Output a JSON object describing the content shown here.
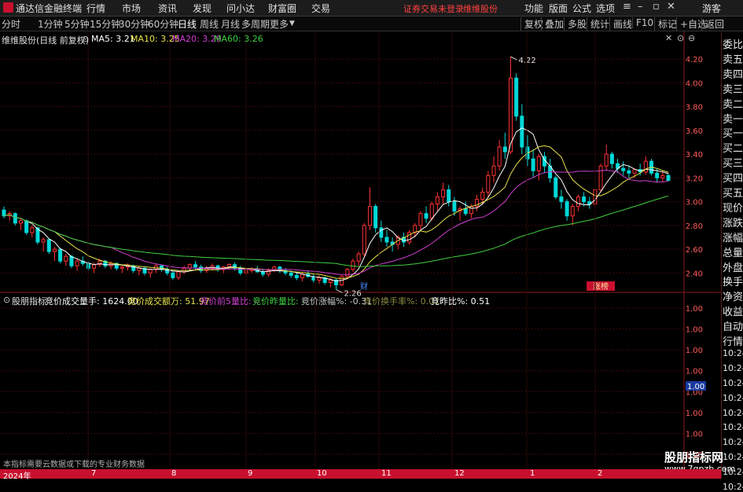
{
  "menubar": {
    "app_name": "通达信金融终端",
    "items": [
      "行情",
      "市场",
      "资讯",
      "发现",
      "问小达",
      "财富圈",
      "交易"
    ],
    "warning": "证券交易未登录",
    "stock_name": "维维股份",
    "right_items": [
      "功能",
      "版面",
      "公式",
      "选项"
    ],
    "guest": "游客"
  },
  "periodbar": {
    "items": [
      "分时",
      "1分钟",
      "5分钟",
      "15分钟",
      "30分钟",
      "60分钟",
      "日线",
      "周线",
      "月线",
      "多周期",
      "更多"
    ],
    "active_index": 6,
    "tools": [
      "复权",
      "叠加",
      "多股",
      "统计",
      "画线",
      "F10",
      "标记",
      "+自选",
      "返回"
    ]
  },
  "main_legend": {
    "title": "维维股份(日线 前复权)",
    "ma": [
      {
        "label": "MA5: 3.21",
        "color": "#ffffff"
      },
      {
        "label": "MA10: 3.25",
        "color": "#e8e34a"
      },
      {
        "label": "MA20: 3.29",
        "color": "#d040d0"
      },
      {
        "label": "MA60: 3.26",
        "color": "#40d040"
      }
    ]
  },
  "sub_legend": {
    "title": "股朋指标",
    "items": [
      {
        "label": "竞价成交量手: 1624.00",
        "color": "#ffffff"
      },
      {
        "label": "竞价成交额万: 51.97",
        "color": "#e8e34a"
      },
      {
        "label": "竞价前5量比: -",
        "color": "#d040d0"
      },
      {
        "label": "竞价昨量比: -",
        "color": "#40d040"
      },
      {
        "label": "竞价涨幅%: -0.31",
        "color": "#c8c8c8"
      },
      {
        "label": "竞价换手率%: 0.01",
        "color": "#8a8a40"
      },
      {
        "label": "竞昨比%: 0.51",
        "color": "#ffffff"
      }
    ]
  },
  "chart_data": [
    {
      "type": "candlestick",
      "title": "维维股份(日线 前复权)",
      "y_ticks": [
        "4.20",
        "4.00",
        "3.80",
        "3.60",
        "3.40",
        "3.20",
        "3.00",
        "2.80",
        "2.60",
        "2.40"
      ],
      "ylim": [
        2.25,
        4.32
      ],
      "x_labels": [
        "2024年",
        "7",
        "8",
        "9",
        "10",
        "11",
        "12",
        "1",
        "2"
      ],
      "annotations": [
        {
          "text": "4.22",
          "value": 4.22
        },
        {
          "text": "2.26",
          "value": 2.26
        }
      ],
      "markers": [
        {
          "text": "财",
          "color": "#4a8cff"
        },
        {
          "text": "涨榜"
        }
      ],
      "series_names": [
        "MA5",
        "MA10",
        "MA20",
        "MA60"
      ],
      "candles": [
        [
          2.93,
          2.96,
          2.86,
          2.88
        ],
        [
          2.88,
          2.92,
          2.84,
          2.9
        ],
        [
          2.9,
          2.91,
          2.8,
          2.82
        ],
        [
          2.82,
          2.86,
          2.76,
          2.84
        ],
        [
          2.84,
          2.85,
          2.72,
          2.74
        ],
        [
          2.74,
          2.8,
          2.7,
          2.78
        ],
        [
          2.78,
          2.79,
          2.64,
          2.66
        ],
        [
          2.66,
          2.7,
          2.58,
          2.68
        ],
        [
          2.68,
          2.69,
          2.56,
          2.58
        ],
        [
          2.58,
          2.62,
          2.5,
          2.6
        ],
        [
          2.6,
          2.61,
          2.48,
          2.5
        ],
        [
          2.5,
          2.56,
          2.46,
          2.54
        ],
        [
          2.54,
          2.55,
          2.44,
          2.46
        ],
        [
          2.46,
          2.52,
          2.42,
          2.5
        ],
        [
          2.5,
          2.54,
          2.46,
          2.48
        ],
        [
          2.48,
          2.5,
          2.42,
          2.44
        ],
        [
          2.44,
          2.49,
          2.4,
          2.47
        ],
        [
          2.47,
          2.52,
          2.45,
          2.5
        ],
        [
          2.5,
          2.51,
          2.44,
          2.46
        ],
        [
          2.46,
          2.5,
          2.43,
          2.48
        ],
        [
          2.48,
          2.49,
          2.42,
          2.44
        ],
        [
          2.44,
          2.47,
          2.4,
          2.45
        ],
        [
          2.45,
          2.48,
          2.42,
          2.46
        ],
        [
          2.46,
          2.47,
          2.4,
          2.42
        ],
        [
          2.42,
          2.46,
          2.38,
          2.44
        ],
        [
          2.44,
          2.45,
          2.38,
          2.4
        ],
        [
          2.4,
          2.44,
          2.36,
          2.43
        ],
        [
          2.43,
          2.48,
          2.4,
          2.46
        ],
        [
          2.46,
          2.47,
          2.41,
          2.43
        ],
        [
          2.43,
          2.45,
          2.38,
          2.4
        ],
        [
          2.4,
          2.42,
          2.34,
          2.36
        ],
        [
          2.36,
          2.42,
          2.34,
          2.41
        ],
        [
          2.41,
          2.46,
          2.39,
          2.44
        ],
        [
          2.44,
          2.48,
          2.42,
          2.47
        ],
        [
          2.47,
          2.5,
          2.43,
          2.45
        ],
        [
          2.45,
          2.47,
          2.4,
          2.42
        ],
        [
          2.42,
          2.46,
          2.4,
          2.44
        ],
        [
          2.44,
          2.48,
          2.42,
          2.46
        ],
        [
          2.46,
          2.47,
          2.41,
          2.43
        ],
        [
          2.43,
          2.46,
          2.4,
          2.45
        ],
        [
          2.45,
          2.48,
          2.43,
          2.47
        ],
        [
          2.47,
          2.49,
          2.42,
          2.44
        ],
        [
          2.44,
          2.46,
          2.38,
          2.4
        ],
        [
          2.4,
          2.44,
          2.37,
          2.42
        ],
        [
          2.42,
          2.45,
          2.4,
          2.43
        ],
        [
          2.43,
          2.46,
          2.4,
          2.41
        ],
        [
          2.41,
          2.43,
          2.37,
          2.39
        ],
        [
          2.39,
          2.44,
          2.37,
          2.42
        ],
        [
          2.42,
          2.46,
          2.41,
          2.45
        ],
        [
          2.45,
          2.46,
          2.4,
          2.42
        ],
        [
          2.42,
          2.44,
          2.38,
          2.4
        ],
        [
          2.4,
          2.42,
          2.36,
          2.38
        ],
        [
          2.38,
          2.41,
          2.34,
          2.36
        ],
        [
          2.36,
          2.4,
          2.33,
          2.39
        ],
        [
          2.39,
          2.42,
          2.36,
          2.37
        ],
        [
          2.37,
          2.39,
          2.32,
          2.34
        ],
        [
          2.34,
          2.38,
          2.31,
          2.36
        ],
        [
          2.36,
          2.37,
          2.3,
          2.32
        ],
        [
          2.32,
          2.36,
          2.28,
          2.34
        ],
        [
          2.34,
          2.35,
          2.26,
          2.3
        ],
        [
          2.3,
          2.38,
          2.29,
          2.37
        ],
        [
          2.37,
          2.44,
          2.35,
          2.43
        ],
        [
          2.43,
          2.52,
          2.41,
          2.5
        ],
        [
          2.5,
          2.58,
          2.46,
          2.56
        ],
        [
          2.56,
          2.82,
          2.54,
          2.8
        ],
        [
          2.8,
          3.12,
          2.76,
          2.96
        ],
        [
          2.96,
          2.98,
          2.74,
          2.78
        ],
        [
          2.78,
          2.84,
          2.66,
          2.7
        ],
        [
          2.7,
          2.76,
          2.62,
          2.66
        ],
        [
          2.66,
          2.7,
          2.58,
          2.64
        ],
        [
          2.64,
          2.72,
          2.6,
          2.7
        ],
        [
          2.7,
          2.74,
          2.62,
          2.66
        ],
        [
          2.66,
          2.76,
          2.64,
          2.74
        ],
        [
          2.74,
          2.82,
          2.7,
          2.8
        ],
        [
          2.8,
          2.92,
          2.76,
          2.9
        ],
        [
          2.9,
          2.96,
          2.82,
          2.86
        ],
        [
          2.86,
          3.0,
          2.84,
          2.98
        ],
        [
          2.98,
          3.08,
          2.92,
          3.04
        ],
        [
          3.04,
          3.16,
          2.98,
          3.1
        ],
        [
          3.1,
          3.14,
          2.96,
          3.0
        ],
        [
          3.0,
          3.04,
          2.88,
          2.92
        ],
        [
          2.92,
          2.96,
          2.84,
          2.94
        ],
        [
          2.94,
          3.0,
          2.88,
          2.9
        ],
        [
          2.9,
          2.98,
          2.86,
          2.96
        ],
        [
          2.96,
          3.06,
          2.92,
          3.02
        ],
        [
          3.02,
          3.12,
          2.98,
          3.08
        ],
        [
          3.08,
          3.26,
          3.04,
          3.22
        ],
        [
          3.22,
          3.38,
          3.16,
          3.3
        ],
        [
          3.3,
          3.52,
          3.26,
          3.46
        ],
        [
          3.46,
          3.58,
          3.36,
          3.42
        ],
        [
          3.42,
          4.22,
          3.4,
          4.04
        ],
        [
          4.04,
          4.08,
          3.68,
          3.72
        ],
        [
          3.72,
          3.82,
          3.4,
          3.46
        ],
        [
          3.46,
          3.56,
          3.3,
          3.36
        ],
        [
          3.36,
          3.44,
          3.2,
          3.26
        ],
        [
          3.26,
          3.4,
          3.18,
          3.38
        ],
        [
          3.38,
          3.42,
          3.24,
          3.3
        ],
        [
          3.3,
          3.36,
          3.16,
          3.2
        ],
        [
          3.2,
          3.22,
          3.02,
          3.04
        ],
        [
          3.04,
          3.1,
          2.94,
          3.0
        ],
        [
          3.0,
          3.02,
          2.84,
          2.88
        ],
        [
          2.88,
          2.98,
          2.8,
          2.96
        ],
        [
          2.96,
          3.06,
          2.92,
          3.04
        ],
        [
          3.04,
          3.08,
          2.96,
          3.0
        ],
        [
          3.0,
          3.04,
          2.94,
          2.98
        ],
        [
          2.98,
          3.12,
          2.96,
          3.1
        ],
        [
          3.1,
          3.32,
          3.08,
          3.3
        ],
        [
          3.3,
          3.48,
          3.26,
          3.4
        ],
        [
          3.4,
          3.42,
          3.28,
          3.32
        ],
        [
          3.32,
          3.36,
          3.24,
          3.28
        ],
        [
          3.28,
          3.34,
          3.22,
          3.26
        ],
        [
          3.26,
          3.3,
          3.2,
          3.24
        ],
        [
          3.24,
          3.28,
          3.2,
          3.27
        ],
        [
          3.27,
          3.32,
          3.22,
          3.25
        ],
        [
          3.25,
          3.38,
          3.23,
          3.34
        ],
        [
          3.34,
          3.36,
          3.22,
          3.24
        ],
        [
          3.24,
          3.28,
          3.16,
          3.2
        ],
        [
          3.2,
          3.26,
          3.16,
          3.22
        ],
        [
          3.22,
          3.24,
          3.17,
          3.18
        ]
      ]
    },
    {
      "type": "line",
      "title": "股朋指标",
      "y_ticks": [
        "1.00",
        "1.00",
        "1.00",
        "1.00",
        "1.00",
        "1.00",
        "1.00",
        "1.00"
      ],
      "current_value_label": "1.00"
    }
  ],
  "sidebar": [
    "委比",
    "卖五",
    "卖四",
    "卖三",
    "卖二",
    "卖一",
    "买一",
    "买二",
    "买三",
    "买四",
    "买五",
    "现价",
    "涨跌",
    "涨幅",
    "总量",
    "外盘",
    "换手",
    "净资",
    "收益",
    "自动",
    "行情",
    "10:24",
    "10:24",
    "10:24",
    "10:24",
    "10:24",
    "10:24",
    "10:24",
    "10:24",
    "10:24",
    "10:24"
  ],
  "footer": {
    "note": "本指标需要云数据或下载的专业财务数据",
    "watermark_main": "股朋指标网",
    "watermark_sub": "www.7gpzb.com"
  },
  "colors": {
    "up": "#ff3232",
    "down": "#00d8d8",
    "ma5": "#ffffff",
    "ma10": "#e8e34a",
    "ma20": "#d040d0",
    "ma60": "#40d040",
    "grid": "#6a1010"
  }
}
